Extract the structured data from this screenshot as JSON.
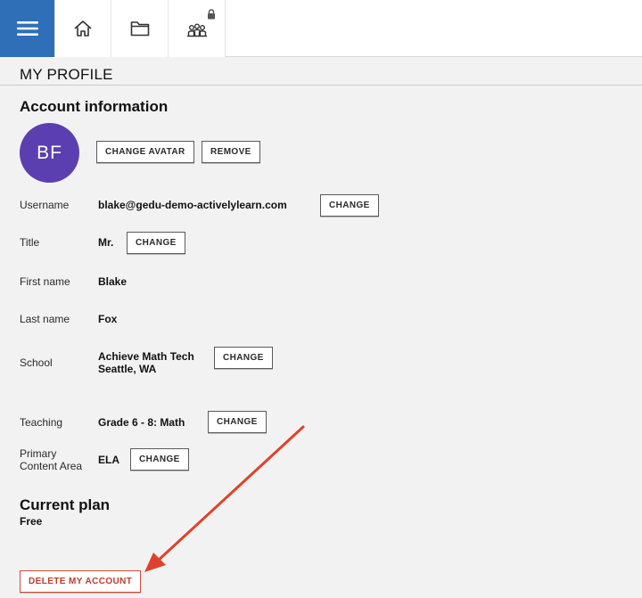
{
  "nav": {
    "menu_icon": "hamburger-icon",
    "home_icon": "home-icon",
    "folder_icon": "folder-icon",
    "classes_icon": "classes-icon",
    "lock_icon": "lock-icon"
  },
  "page": {
    "title": "MY PROFILE"
  },
  "account": {
    "heading": "Account information",
    "avatar_initials": "BF",
    "avatar_color": "#5b3fb0",
    "change_avatar_label": "CHANGE AVATAR",
    "remove_label": "REMOVE",
    "fields": {
      "username": {
        "label": "Username",
        "value": "blake@gedu-demo-activelylearn.com",
        "button": "CHANGE"
      },
      "title": {
        "label": "Title",
        "value": "Mr.",
        "button": "CHANGE"
      },
      "first_name": {
        "label": "First name",
        "value": "Blake"
      },
      "last_name": {
        "label": "Last name",
        "value": "Fox"
      },
      "school": {
        "label": "School",
        "value_line1": "Achieve Math Tech",
        "value_line2": "Seattle, WA",
        "button": "CHANGE"
      },
      "teaching": {
        "label": "Teaching",
        "value": "Grade 6 - 8: Math",
        "button": "CHANGE"
      },
      "primary_content": {
        "label_line1": "Primary",
        "label_line2": "Content Area",
        "value": "ELA",
        "button": "CHANGE"
      }
    }
  },
  "plan": {
    "heading": "Current plan",
    "value": "Free",
    "delete_label": "DELETE MY ACCOUNT"
  },
  "colors": {
    "accent": "#2f6fb7",
    "danger": "#c43a2a",
    "arrow": "#e0412b"
  }
}
